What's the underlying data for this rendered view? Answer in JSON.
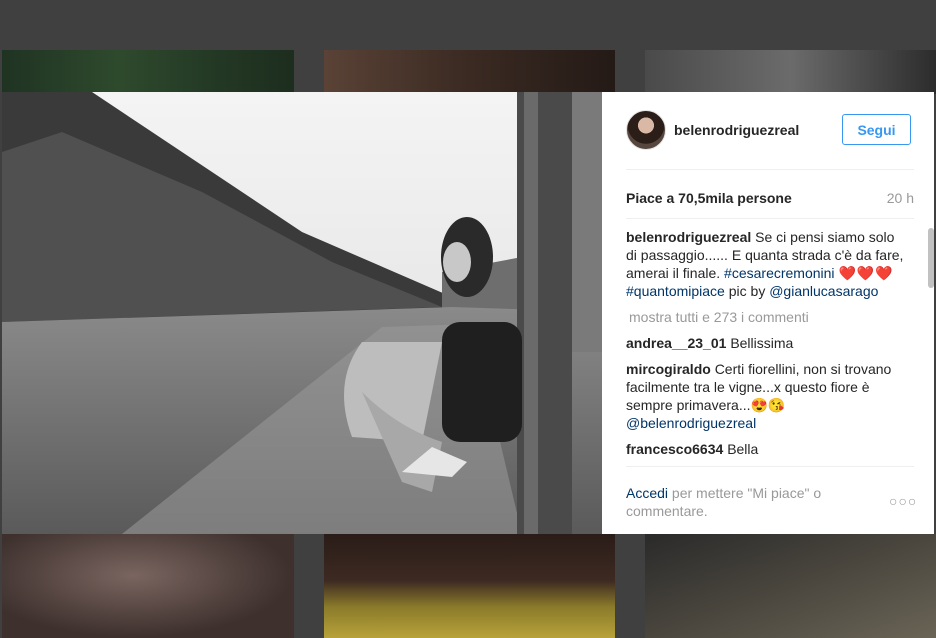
{
  "post": {
    "username": "belenrodriguezreal",
    "follow_label": "Segui",
    "likes": "Piace a 70,5mila persone",
    "time": "20 h"
  },
  "caption": {
    "user": "belenrodriguezreal",
    "text": "Se ci pensi siamo solo di passaggio...... E quanta strada c'è da fare, amerai il finale.",
    "hashtag1": "#cesarecremonini",
    "hearts": "❤️❤️❤️",
    "hashtag2": "#quantomipiace",
    "pic_by": "pic by",
    "mention": "@gianlucasarago"
  },
  "show_all": "mostra tutti e 273 i commenti",
  "comments": [
    {
      "user": "andrea__23_01",
      "text": "Bellissima"
    },
    {
      "user": "mircogiraldo",
      "text": "Certi fiorellini, non si trovano facilmente tra le vigne...x questo fiore è sempre primavera...😍😘",
      "mention": "@belenrodriguezreal"
    },
    {
      "user": "francesco6634",
      "text": "Bella"
    }
  ],
  "footer": {
    "login": "Accedi",
    "rest": "per mettere \"Mi piace\" o commentare.",
    "options": "○○○"
  },
  "colors": {
    "accent": "#3897f0",
    "link": "#003569",
    "muted": "#999999",
    "text": "#262626"
  }
}
